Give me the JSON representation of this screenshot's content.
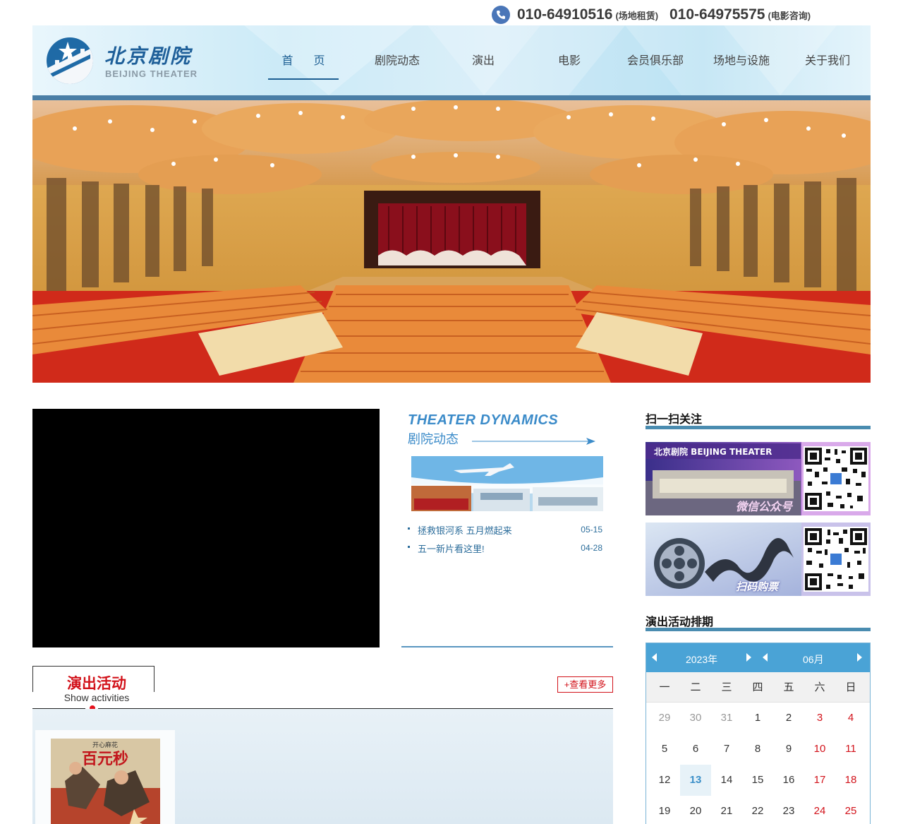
{
  "contact": {
    "phone1": "010-64910516",
    "phone1_note": "(场地租赁)",
    "phone2": "010-64975575",
    "phone2_note": "(电影咨询)"
  },
  "brand": {
    "name_cn": "北京剧院",
    "name_en": "BEIJING THEATER",
    "color": "#1e5f99"
  },
  "nav": [
    {
      "label": "首 页",
      "active": true
    },
    {
      "label": "剧院动态"
    },
    {
      "label": "演出"
    },
    {
      "label": "电影"
    },
    {
      "label": "会员俱乐部"
    },
    {
      "label": "场地与设施"
    },
    {
      "label": "关于我们"
    }
  ],
  "dynamics": {
    "title_en": "THEATER DYNAMICS",
    "title_cn": "剧院动态",
    "news": [
      {
        "title": "拯救银河系 五月燃起来",
        "date": "05-15"
      },
      {
        "title": "五一新片看这里!",
        "date": "04-28"
      }
    ]
  },
  "activities": {
    "title_cn": "演出活动",
    "title_en": "Show activities",
    "more": "+查看更多",
    "poster": {
      "tag": "开心麻花",
      "title": "百元秒"
    }
  },
  "follow": {
    "title": "扫一扫关注",
    "cards": [
      {
        "label": "微信公众号",
        "sign": "北京剧院  BEIJING THEATER"
      },
      {
        "label": "扫码购票"
      }
    ]
  },
  "schedule": {
    "title": "演出活动排期",
    "year": "2023年",
    "month": "06月",
    "weekdays": [
      "一",
      "二",
      "三",
      "四",
      "五",
      "六",
      "日"
    ],
    "rows": [
      [
        {
          "d": "29",
          "t": "prev"
        },
        {
          "d": "30",
          "t": "prev"
        },
        {
          "d": "31",
          "t": "prev"
        },
        {
          "d": "1"
        },
        {
          "d": "2"
        },
        {
          "d": "3",
          "t": "wkd"
        },
        {
          "d": "4",
          "t": "wkd"
        }
      ],
      [
        {
          "d": "5"
        },
        {
          "d": "6"
        },
        {
          "d": "7"
        },
        {
          "d": "8"
        },
        {
          "d": "9"
        },
        {
          "d": "10",
          "t": "wkd"
        },
        {
          "d": "11",
          "t": "wkd"
        }
      ],
      [
        {
          "d": "12"
        },
        {
          "d": "13",
          "t": "today"
        },
        {
          "d": "14"
        },
        {
          "d": "15"
        },
        {
          "d": "16"
        },
        {
          "d": "17",
          "t": "wkd"
        },
        {
          "d": "18",
          "t": "wkd"
        }
      ],
      [
        {
          "d": "19"
        },
        {
          "d": "20"
        },
        {
          "d": "21"
        },
        {
          "d": "22"
        },
        {
          "d": "23"
        },
        {
          "d": "24",
          "t": "wkd"
        },
        {
          "d": "25",
          "t": "wkd"
        }
      ]
    ]
  },
  "icons": [
    "phone-icon",
    "logo-icon",
    "arrow-right-icon",
    "prev-year-icon",
    "next-year-icon",
    "prev-month-icon",
    "next-month-icon"
  ]
}
